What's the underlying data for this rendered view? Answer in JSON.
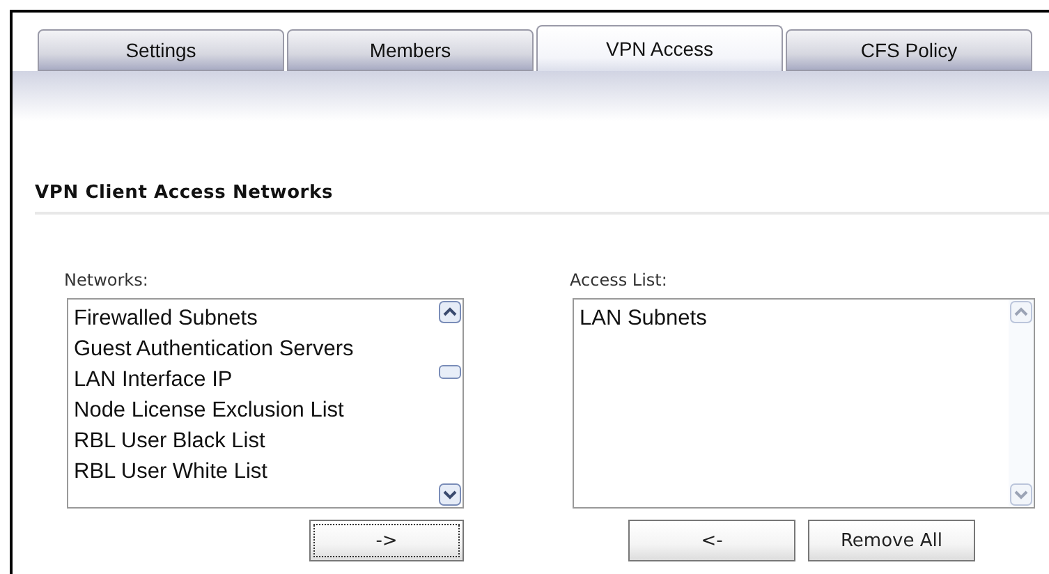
{
  "tabs": [
    {
      "label": "Settings",
      "selected": false
    },
    {
      "label": "Members",
      "selected": false
    },
    {
      "label": "VPN Access",
      "selected": true
    },
    {
      "label": "CFS Policy",
      "selected": false
    }
  ],
  "section": {
    "title": "VPN Client Access Networks"
  },
  "networks": {
    "label": "Networks:",
    "items": [
      "Firewalled Subnets",
      "Guest Authentication Servers",
      "LAN Interface IP",
      "Node License Exclusion List",
      "RBL User Black List",
      "RBL User White List"
    ],
    "buttons": [
      "->"
    ]
  },
  "access_list": {
    "label": "Access List:",
    "items": [
      "LAN Subnets"
    ],
    "buttons": [
      "<-",
      "Remove All"
    ]
  }
}
